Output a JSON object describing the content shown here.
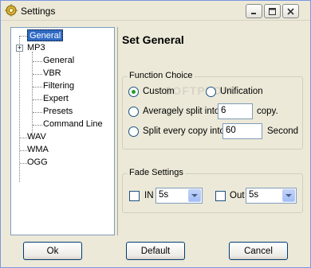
{
  "window": {
    "title": "Settings",
    "minimize_icon": "minimize-icon",
    "maximize_icon": "maximize-icon",
    "close_icon": "close-icon"
  },
  "tree": {
    "items": [
      {
        "label": "General",
        "level": 0,
        "selected": true
      },
      {
        "label": "MP3",
        "level": 0,
        "expanded": true
      },
      {
        "label": "General",
        "level": 1
      },
      {
        "label": "VBR",
        "level": 1
      },
      {
        "label": "Filtering",
        "level": 1
      },
      {
        "label": "Expert",
        "level": 1
      },
      {
        "label": "Presets",
        "level": 1
      },
      {
        "label": "Command Line",
        "level": 1
      },
      {
        "label": "WAV",
        "level": 0
      },
      {
        "label": "WMA",
        "level": 0
      },
      {
        "label": "OGG",
        "level": 0
      }
    ],
    "expander_symbol": "+"
  },
  "panel": {
    "title": "Set General",
    "function_choice": {
      "legend": "Function Choice",
      "custom_label": "Custom",
      "unification_label": "Unification",
      "avg_split_label": "Averagely split into",
      "avg_split_value": "6",
      "avg_split_unit": "copy.",
      "split_every_label": "Split every copy into",
      "split_every_value": "60",
      "split_every_unit": "Second",
      "selected": "Custom"
    },
    "fade_settings": {
      "legend": "Fade Settings",
      "in_label": "IN",
      "in_value": "5s",
      "out_label": "Out",
      "out_value": "5s"
    }
  },
  "buttons": {
    "ok": "Ok",
    "default": "Default",
    "cancel": "Cancel"
  },
  "colors": {
    "selection": "#316ac5",
    "radio_dot": "#21a121",
    "window_bg": "#ece9d8"
  }
}
